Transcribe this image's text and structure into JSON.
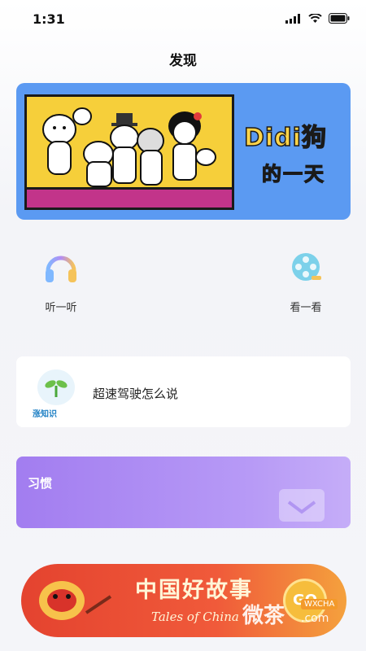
{
  "status_bar": {
    "time": "1:31"
  },
  "header": {
    "title": "发现"
  },
  "banner": {
    "title": "Didi狗",
    "subtitle": "的一天"
  },
  "quick_entries": [
    {
      "label": "听一听",
      "icon": "headphones-icon"
    },
    {
      "label": "看一看",
      "icon": "film-reel-icon"
    }
  ],
  "tip_card": {
    "logo_text": "涨知识",
    "text": "超速驾驶怎么说"
  },
  "habit_card": {
    "title": "习惯"
  },
  "promo": {
    "title": "中国好故事",
    "subtitle": "Tales of China",
    "go_label": "GO"
  },
  "watermark": {
    "main": "微茶",
    "domain": ".com",
    "tag": "WXCHA"
  },
  "colors": {
    "banner_bg": "#5b9af2",
    "habit_bg": "#a27df0",
    "promo_bg": "#e4432f"
  }
}
